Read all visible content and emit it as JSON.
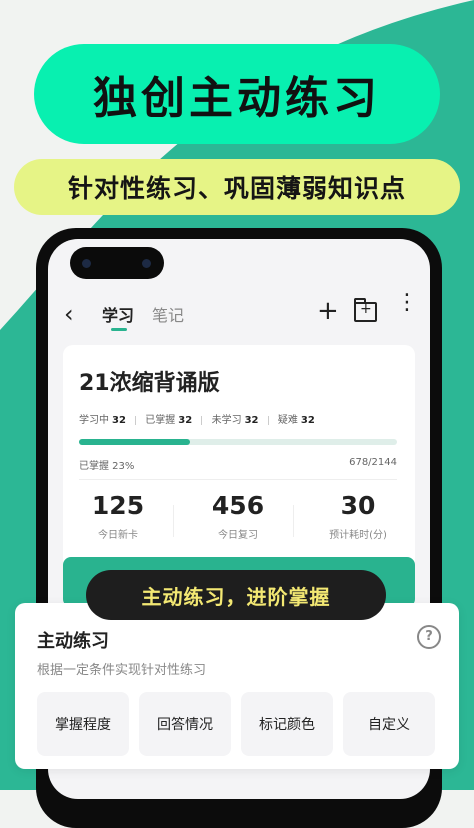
{
  "headline": "独创主动练习",
  "subheadline": "针对性练习、巩固薄弱知识点",
  "nav": {
    "tab_study": "学习",
    "tab_notes": "笔记",
    "back_icon": "‹",
    "add_icon": "+",
    "more_icon": "⋮"
  },
  "deck": {
    "title": "21浓缩背诵版",
    "stats": [
      {
        "label": "学习中",
        "value": "32"
      },
      {
        "label": "已掌握",
        "value": "32"
      },
      {
        "label": "未学习",
        "value": "32"
      },
      {
        "label": "疑难",
        "value": "32"
      }
    ],
    "progress_fraction": 0.35,
    "mastered_text": "已掌握 23%",
    "count_text": "678/2144",
    "metrics": [
      {
        "value": "125",
        "label": "今日新卡"
      },
      {
        "value": "456",
        "label": "今日复习"
      },
      {
        "value": "30",
        "label": "预计耗时(分)"
      }
    ]
  },
  "callout": "主动练习，进阶掌握",
  "sheet": {
    "title": "主动练习",
    "subtitle": "根据一定条件实现针对性练习",
    "help_icon": "?",
    "options": [
      "掌握程度",
      "回答情况",
      "标记颜色",
      "自定义"
    ]
  },
  "colors": {
    "teal_bg": "#2cb795",
    "mint_pill": "#08f0b0",
    "lime_pill": "#e6f486",
    "accent": "#29b38f",
    "callout_text": "#f3e873"
  }
}
